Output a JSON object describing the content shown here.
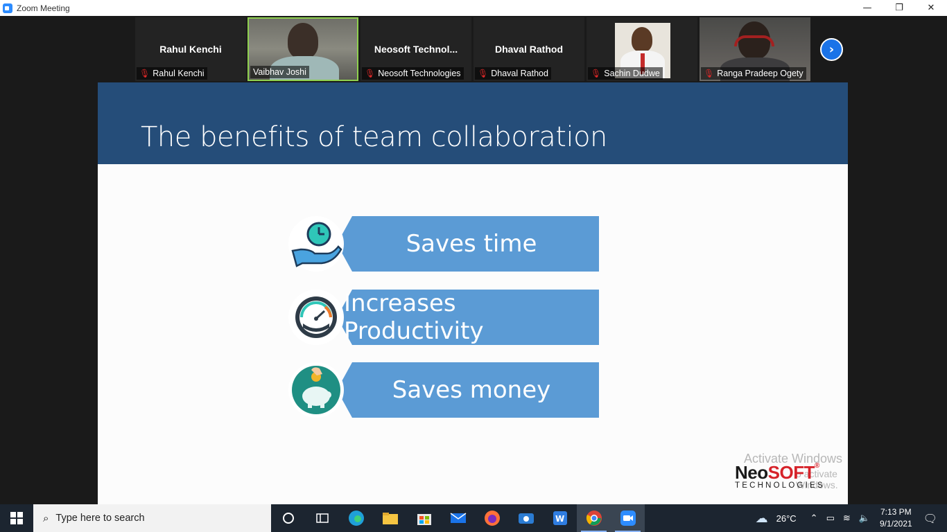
{
  "window": {
    "title": "Zoom Meeting",
    "controls": [
      "—",
      "❐",
      "✕"
    ]
  },
  "participants": [
    {
      "big_name": "Rahul Kenchi",
      "tag": "Rahul Kenchi",
      "muted": true,
      "video": false
    },
    {
      "big_name": "",
      "tag": "Vaibhav Joshi",
      "muted": false,
      "video": true,
      "active_speaker": true
    },
    {
      "big_name": "Neosoft  Technol...",
      "tag": "Neosoft Technologies",
      "muted": true,
      "video": false
    },
    {
      "big_name": "Dhaval Rathod",
      "tag": "Dhaval Rathod",
      "muted": true,
      "video": false
    },
    {
      "big_name": "",
      "tag": "Sachin Dudwe",
      "muted": true,
      "video": true
    },
    {
      "big_name": "",
      "tag": "Ranga Pradeep Ogety",
      "muted": true,
      "video": true
    }
  ],
  "slide": {
    "title": "The benefits of team collaboration",
    "benefits": [
      {
        "label": "Saves time",
        "icon": "clock-in-hand-icon"
      },
      {
        "label": "Increases Productivity",
        "icon": "productivity-gauge-icon"
      },
      {
        "label": "Saves money",
        "icon": "piggy-bank-icon"
      }
    ],
    "logo": {
      "neo": "Neo",
      "soft": "SOFT",
      "reg": "®",
      "sub": "TECHNOLOGIES"
    },
    "watermark": {
      "line1": "Activate Windows",
      "line2": "o activate Windows."
    }
  },
  "taskbar": {
    "search_placeholder": "Type here to search",
    "weather": "26°C",
    "time": "7:13 PM",
    "date": "9/1/2021"
  }
}
